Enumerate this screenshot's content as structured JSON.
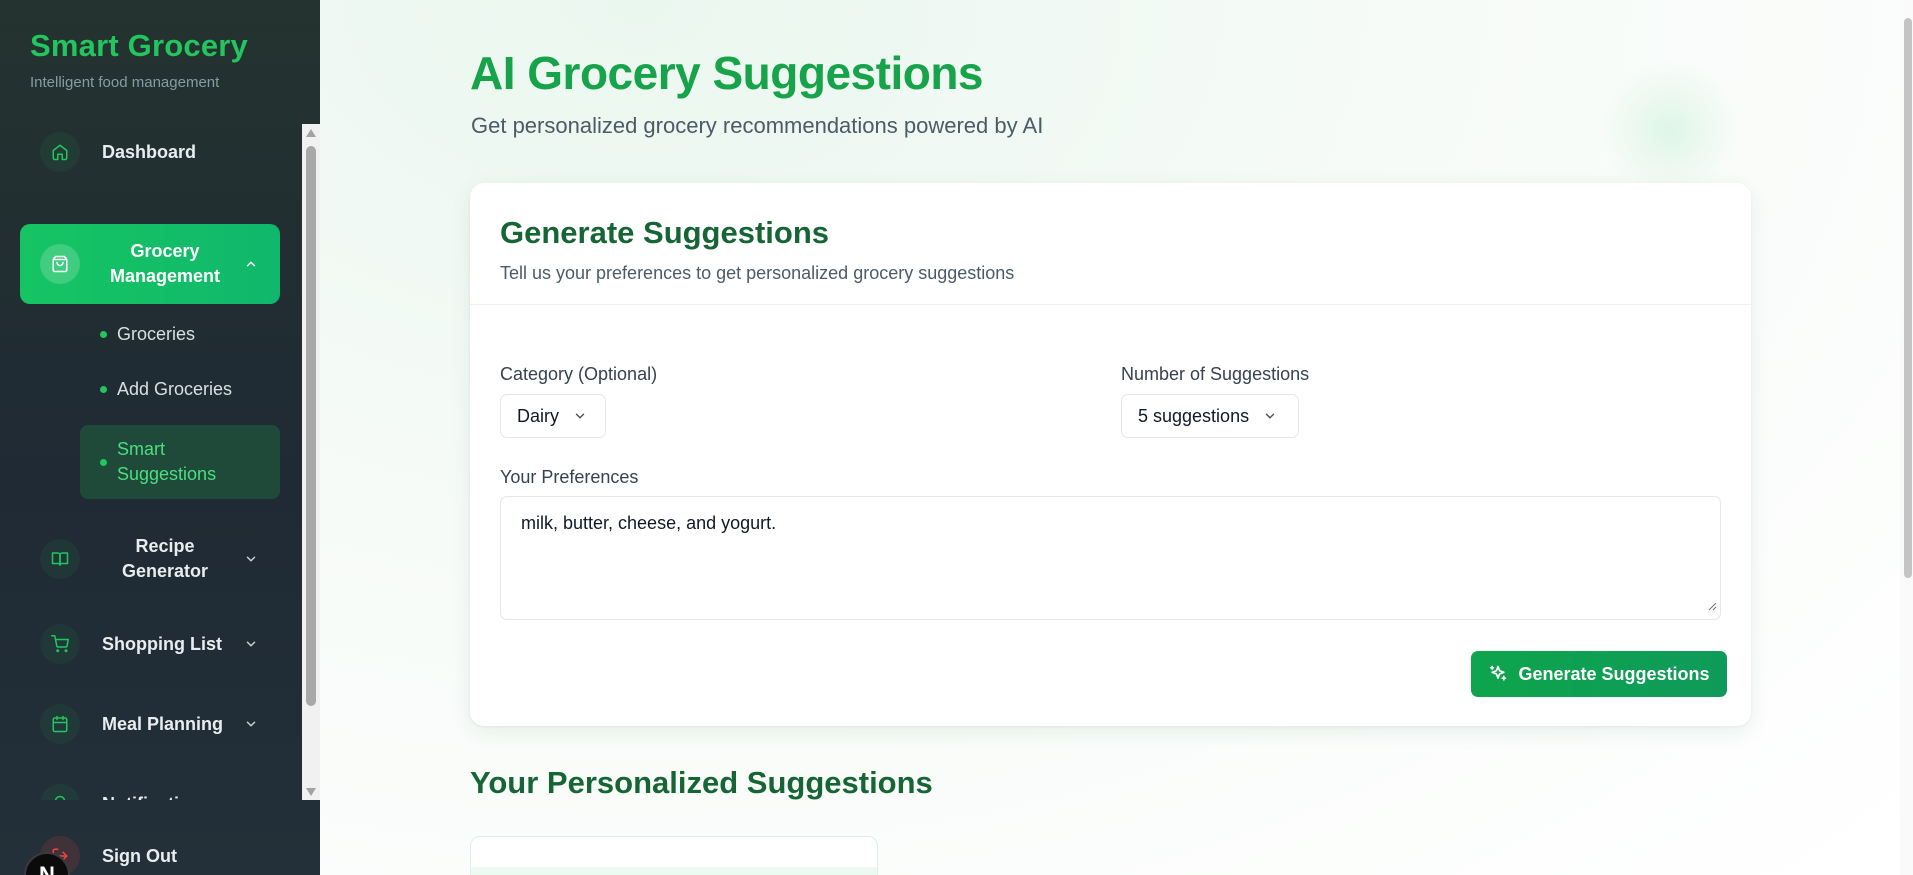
{
  "brand": {
    "title": "Smart Grocery",
    "subtitle": "Intelligent food management"
  },
  "sidebar": {
    "items": [
      {
        "label": "Dashboard",
        "icon": "home-icon"
      },
      {
        "label": "Grocery Management",
        "icon": "shopping-bag-icon",
        "expanded": true
      },
      {
        "label": "Recipe Generator",
        "icon": "book-icon"
      },
      {
        "label": "Shopping List",
        "icon": "cart-icon"
      },
      {
        "label": "Meal Planning",
        "icon": "calendar-icon"
      },
      {
        "label": "Notifications",
        "icon": "bell-icon"
      }
    ],
    "subitems": [
      {
        "label": "Groceries"
      },
      {
        "label": "Add Groceries"
      },
      {
        "label": "Smart Suggestions",
        "active": true
      }
    ],
    "signout": {
      "label": "Sign Out",
      "icon": "log-out-icon"
    },
    "badge": "N"
  },
  "page": {
    "title": "AI Grocery Suggestions",
    "subtitle": "Get personalized grocery recommendations powered by AI"
  },
  "form": {
    "title": "Generate Suggestions",
    "description": "Tell us your preferences to get personalized grocery suggestions",
    "category_label": "Category (Optional)",
    "category_value": "Dairy",
    "count_label": "Number of Suggestions",
    "count_value": "5 suggestions",
    "preferences_label": "Your Preferences",
    "preferences_value": "milk, butter, cheese, and yogurt.",
    "submit_label": "Generate Suggestions"
  },
  "results": {
    "title": "Your Personalized Suggestions"
  },
  "colors": {
    "accent": "#22c55e",
    "accent_dark": "#166534",
    "sidebar_bg": "#24332f"
  }
}
